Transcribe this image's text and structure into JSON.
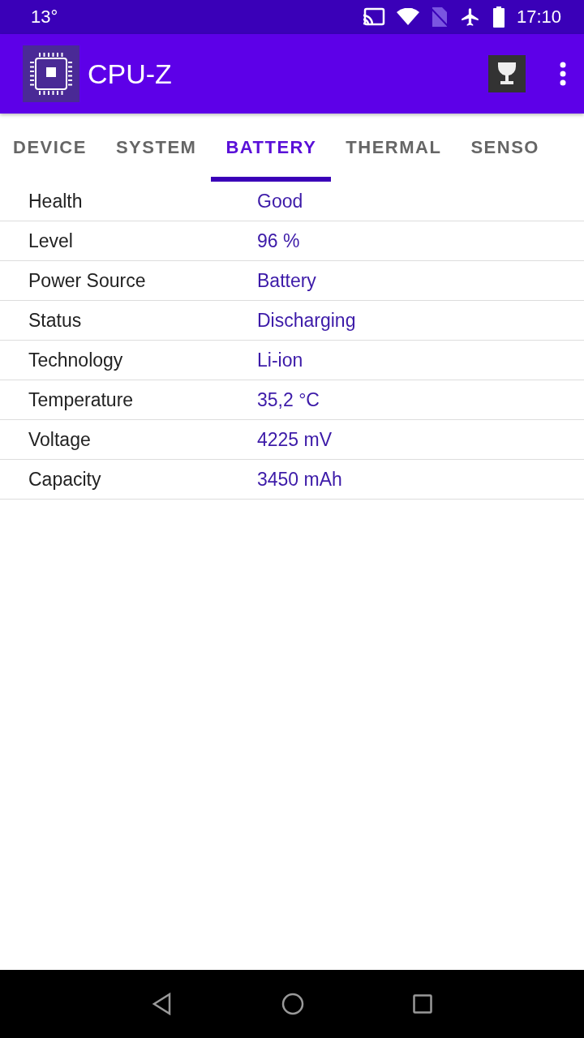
{
  "status_bar": {
    "temperature": "13°",
    "time": "17:10"
  },
  "app_bar": {
    "title": "CPU-Z"
  },
  "tabs": [
    {
      "label": "DEVICE",
      "selected": false
    },
    {
      "label": "SYSTEM",
      "selected": false
    },
    {
      "label": "BATTERY",
      "selected": true
    },
    {
      "label": "THERMAL",
      "selected": false
    },
    {
      "label": "SENSO",
      "selected": false
    }
  ],
  "rows": [
    {
      "label": "Health",
      "value": "Good"
    },
    {
      "label": "Level",
      "value": "96 %"
    },
    {
      "label": "Power Source",
      "value": "Battery"
    },
    {
      "label": "Status",
      "value": "Discharging"
    },
    {
      "label": "Technology",
      "value": "Li-ion"
    },
    {
      "label": "Temperature",
      "value": "35,2 °C"
    },
    {
      "label": "Voltage",
      "value": "4225 mV"
    },
    {
      "label": "Capacity",
      "value": "3450 mAh"
    }
  ]
}
